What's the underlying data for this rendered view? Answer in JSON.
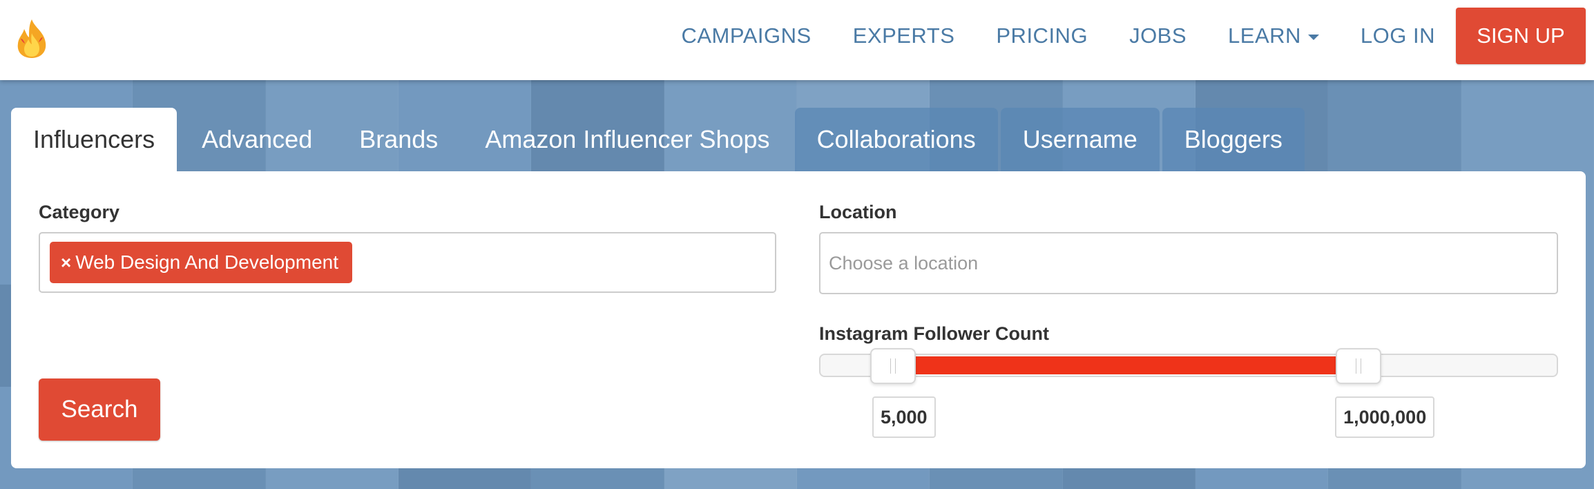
{
  "header": {
    "logo_icon": "fire-icon",
    "nav": {
      "campaigns": "CAMPAIGNS",
      "experts": "EXPERTS",
      "pricing": "PRICING",
      "jobs": "JOBS",
      "learn": "LEARN",
      "login": "LOG IN",
      "signup": "SIGN UP"
    }
  },
  "tabs": [
    {
      "label": "Influencers",
      "active": true
    },
    {
      "label": "Advanced"
    },
    {
      "label": "Brands"
    },
    {
      "label": "Amazon Influencer Shops"
    },
    {
      "label": "Collaborations"
    },
    {
      "label": "Username"
    },
    {
      "label": "Bloggers"
    }
  ],
  "search_form": {
    "category": {
      "label": "Category",
      "selected_chip": "Web Design And Development",
      "remove_symbol": "×"
    },
    "location": {
      "label": "Location",
      "placeholder": "Choose a location",
      "value": ""
    },
    "followers": {
      "label": "Instagram Follower Count",
      "min_display": "5,000",
      "max_display": "1,000,000",
      "min_fraction": 0.1,
      "max_fraction": 0.73
    },
    "search_button": "Search"
  },
  "colors": {
    "accent": "#e04a34",
    "slider_range": "#ef3319",
    "nav_text": "#4a7aa5",
    "background": "#6e95bb"
  }
}
